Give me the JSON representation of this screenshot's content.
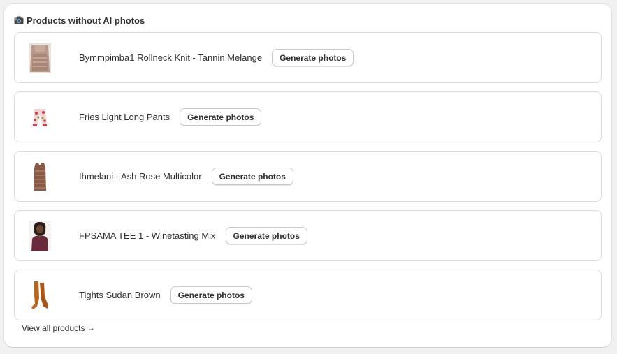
{
  "header": {
    "icon": "camera-icon",
    "title": "Products without AI photos"
  },
  "products": [
    {
      "name": "Bymmpimba1 Rollneck Knit - Tannin Melange",
      "button_label": "Generate photos",
      "thumbnail": "knit-sweater-thumbnail"
    },
    {
      "name": "Fries Light Long Pants",
      "button_label": "Generate photos",
      "thumbnail": "pants-thumbnail"
    },
    {
      "name": "Ihmelani - Ash Rose Multicolor",
      "button_label": "Generate photos",
      "thumbnail": "dress-thumbnail"
    },
    {
      "name": "FPSAMA TEE 1 - Winetasting Mix",
      "button_label": "Generate photos",
      "thumbnail": "tee-model-thumbnail"
    },
    {
      "name": "Tights Sudan Brown",
      "button_label": "Generate photos",
      "thumbnail": "tights-thumbnail"
    }
  ],
  "footer": {
    "view_all_label": "View all products",
    "arrow_icon": "arrow-right-icon"
  },
  "colors": {
    "page_background": "#f1f1f1",
    "card_background": "#ffffff",
    "text": "#303030",
    "border": "#dcdcdc"
  }
}
